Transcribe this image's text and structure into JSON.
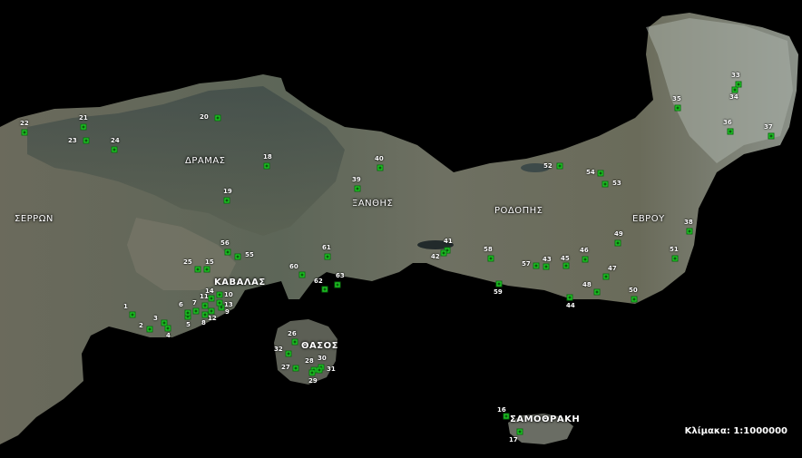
{
  "map": {
    "regions": [
      {
        "id": "serres",
        "label": "ΣΕΡΡΩΝ"
      },
      {
        "id": "drama",
        "label": "ΔΡΑΜΑΣ"
      },
      {
        "id": "xanthi",
        "label": "ΞΑΝΘΗΣ"
      },
      {
        "id": "rodopi",
        "label": "ΡΟΔΟΠΗΣ"
      },
      {
        "id": "evros",
        "label": "ΕΒΡΟΥ"
      },
      {
        "id": "kavala",
        "label": "ΚΑΒΑΛΑΣ"
      },
      {
        "id": "thasos",
        "label": "ΘΑΣΟΣ"
      },
      {
        "id": "samothraki",
        "label": "ΣΑΜΟΘΡΑΚΗ"
      }
    ],
    "stations": [
      "1",
      "2",
      "3",
      "4",
      "5",
      "6",
      "7",
      "8",
      "9",
      "10",
      "11",
      "12",
      "13",
      "14",
      "15",
      "16",
      "17",
      "18",
      "19",
      "20",
      "21",
      "22",
      "23",
      "24",
      "25",
      "26",
      "27",
      "28",
      "29",
      "30",
      "31",
      "32",
      "33",
      "34",
      "35",
      "36",
      "37",
      "38",
      "39",
      "40",
      "41",
      "42",
      "43",
      "44",
      "45",
      "46",
      "47",
      "48",
      "49",
      "50",
      "51",
      "52",
      "53",
      "54",
      "55",
      "56",
      "57",
      "58",
      "59",
      "60",
      "61",
      "62",
      "63"
    ],
    "scale": "Κλίμακα: 1:1000000"
  }
}
